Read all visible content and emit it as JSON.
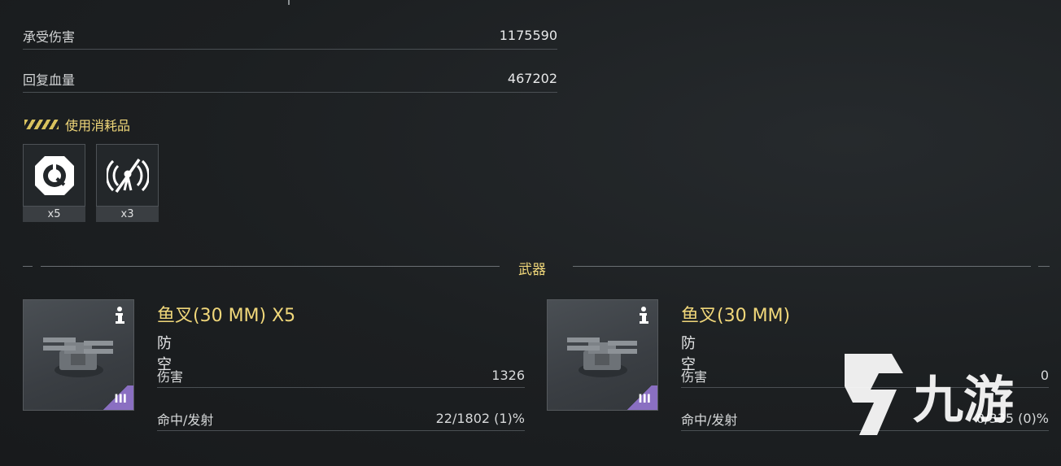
{
  "stats": [
    {
      "label": "承受伤害",
      "value": "1175590"
    },
    {
      "label": "回复血量",
      "value": "467202"
    }
  ],
  "consumables": {
    "heading": "使用消耗品",
    "items": [
      {
        "icon": "repair-kit-icon",
        "count": "x5"
      },
      {
        "icon": "signal-jammer-icon",
        "count": "x3"
      }
    ]
  },
  "weapons_section": {
    "title": "武器",
    "items": [
      {
        "name": "鱼叉(30 MM) X5",
        "type": "防空",
        "tier": "III",
        "rows": [
          {
            "label": "伤害",
            "value": "1326"
          },
          {
            "label": "命中/发射",
            "value": "22/1802 (1)%"
          }
        ]
      },
      {
        "name": "鱼叉(30 MM)",
        "type": "防空",
        "tier": "III",
        "rows": [
          {
            "label": "伤害",
            "value": "0"
          },
          {
            "label": "命中/发射",
            "value": "0/335 (0)%"
          }
        ]
      }
    ]
  },
  "watermark": {
    "text": "九游"
  },
  "colors": {
    "accent": "#f0d77a",
    "tier_purple": "#8a6fc2",
    "background": "#1c1f21"
  }
}
